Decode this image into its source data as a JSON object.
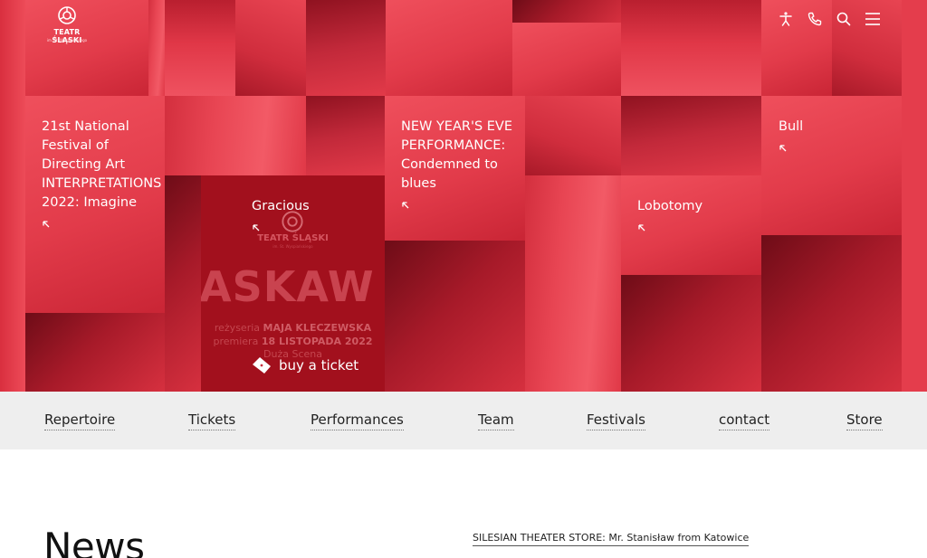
{
  "header": {
    "logo_text": "TEATR ŚLĄSKI",
    "logo_subtext": "im. St. Wyspiańskiego",
    "icons": [
      "accessibility-icon",
      "phone-icon",
      "search-icon",
      "menu-icon"
    ]
  },
  "hero": {
    "items": [
      {
        "title": "21st National Festival of Directing Art INTERPRETATIONS 2022: Imagine"
      },
      {
        "title": "Gracious"
      },
      {
        "title": "NEW YEAR'S EVE PERFORMANCE: Condemned to blues"
      },
      {
        "title": "Lobotomy"
      },
      {
        "title": "Bull"
      }
    ],
    "poster": {
      "big_text": "ASKAW",
      "line1_label": "reżyseria",
      "line1_value": "MAJA KLECZEWSKA",
      "line2_label": "premiera",
      "line2_value": "18 LISTOPADA 2022",
      "line3": "Duża Scena"
    },
    "buy_ticket": "buy a ticket"
  },
  "nav": {
    "items": [
      "Repertoire",
      "Tickets",
      "Performances",
      "Team",
      "Festivals",
      "contact",
      "Store"
    ]
  },
  "main": {
    "news_heading": "News",
    "featured_link": "SILESIAN THEATER STORE: Mr. Stanisław from Katowice"
  },
  "colors": {
    "hero_red": "#e23a49",
    "poster_red": "#a2101d",
    "nav_bg": "#eeeeee"
  }
}
